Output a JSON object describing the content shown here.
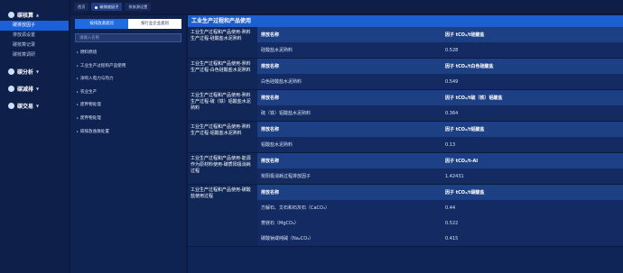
{
  "nav": {
    "groups": [
      {
        "label": "碳核算",
        "open": true,
        "subs": [
          {
            "label": "碳排放因子",
            "active": true
          },
          {
            "label": "排放源设置",
            "active": false
          },
          {
            "label": "碳核算记录",
            "active": false
          },
          {
            "label": "碳核算调研",
            "active": false
          }
        ]
      },
      {
        "label": "碳分析",
        "open": false,
        "subs": []
      },
      {
        "label": "碳减排",
        "open": false,
        "subs": []
      },
      {
        "label": "碳交易",
        "open": false,
        "subs": []
      }
    ]
  },
  "tabs": [
    {
      "label": "首页",
      "active": false,
      "dot": false
    },
    {
      "label": "碳排放因子",
      "active": true,
      "dot": true
    },
    {
      "label": "排放源设置",
      "active": false,
      "dot": false
    }
  ],
  "categories": {
    "toggle_left": "按排放源类别",
    "toggle_right": "按行业企业类别",
    "search_placeholder": "请输入名称",
    "items": [
      "燃料燃烧",
      "工业生产过程和产品使用",
      "净购入电力与热力",
      "农业生产",
      "废弃物处理",
      "废弃物处理",
      "碳排放逸散处置"
    ]
  },
  "main": {
    "title": "工业生产过程和产品使用",
    "groups": [
      {
        "label": "工业生产过程和产品使用-熟料生产过程-硅酸盐水泥熟料",
        "header": [
          "排放名称",
          "因子 tCO₂/t硅酸盐"
        ],
        "rows": [
          [
            "硅酸盐水泥熟料",
            "0.528"
          ]
        ]
      },
      {
        "label": "工业生产过程和产品使用-熟料生产过程-白色硅酸盐水泥熟料",
        "header": [
          "排放名称",
          "因子 tCO₂/t白色硅酸盐"
        ],
        "rows": [
          [
            "白色硅酸盐水泥熟料",
            "0.549"
          ]
        ]
      },
      {
        "label": "工业生产过程和产品使用-熟料生产过程-硫（铁）铝酸盐水泥熟料",
        "header": [
          "排放名称",
          "因子 tCO₂/t硫（铁）铝酸盐"
        ],
        "rows": [
          [
            "硫（铁）铝酸盐水泥熟料",
            "0.364"
          ]
        ]
      },
      {
        "label": "工业生产过程和产品使用-熟料生产过程-铝酸盐水泥熟料",
        "header": [
          "排放名称",
          "因子 tCO₂/t铝酸盐"
        ],
        "rows": [
          [
            "铝酸盐水泥熟料",
            "0.13"
          ]
        ]
      },
      {
        "label": "工业生产过程和产品使用-能源作为原材料使用-碳质阳极消耗过程",
        "header": [
          "排放名称",
          "因子 tCO₂/t-Al"
        ],
        "rows": [
          [
            "炭阳极消耗过程排放因子",
            "1.42431"
          ]
        ]
      },
      {
        "label": "工业生产过程和产品使用-碳酸盐使用过程",
        "header": [
          "排放名称",
          "因子 tCO₂/t碳酸盐"
        ],
        "rows": [
          [
            "方解石、文石和石灰石（CaCO₃）",
            "0.44"
          ],
          [
            "菱镁石（MgCO₃）",
            "0.522"
          ],
          [
            "碳酸钠或纯碱（Na₂CO₃）",
            "0.415"
          ]
        ]
      }
    ]
  }
}
